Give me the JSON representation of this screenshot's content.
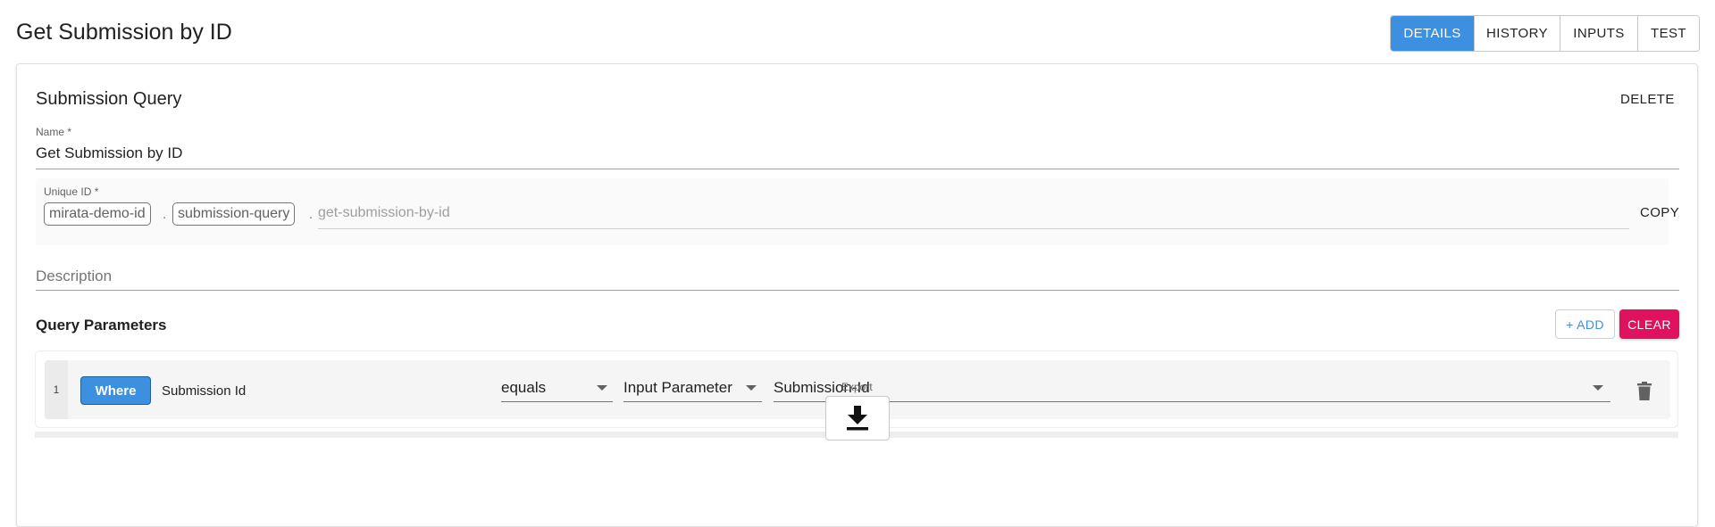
{
  "page": {
    "title": "Get Submission by ID"
  },
  "tabs": [
    {
      "label": "DETAILS",
      "active": true
    },
    {
      "label": "HISTORY",
      "active": false
    },
    {
      "label": "INPUTS",
      "active": false
    },
    {
      "label": "TEST",
      "active": false
    }
  ],
  "card": {
    "title": "Submission Query",
    "delete_label": "DELETE",
    "name": {
      "label": "Name *",
      "value": "Get Submission by ID"
    },
    "unique_id": {
      "label": "Unique ID *",
      "chips": [
        "mirata-demo-id",
        "submission-query"
      ],
      "separator": ".",
      "placeholder": "get-submission-by-id",
      "copy_label": "COPY"
    },
    "description": {
      "placeholder": "Description"
    }
  },
  "query_parameters": {
    "title": "Query Parameters",
    "add_label": "+ ADD",
    "clear_label": "CLEAR",
    "rows": [
      {
        "index": "1",
        "clause": "Where",
        "field": "Submission Id",
        "operator": "equals",
        "source": "Input Parameter",
        "value": "Submission-Id"
      }
    ]
  },
  "export": {
    "label": "Export",
    "icon": "download-icon"
  },
  "colors": {
    "accent": "#3d8fe0",
    "danger": "#e0115f"
  }
}
